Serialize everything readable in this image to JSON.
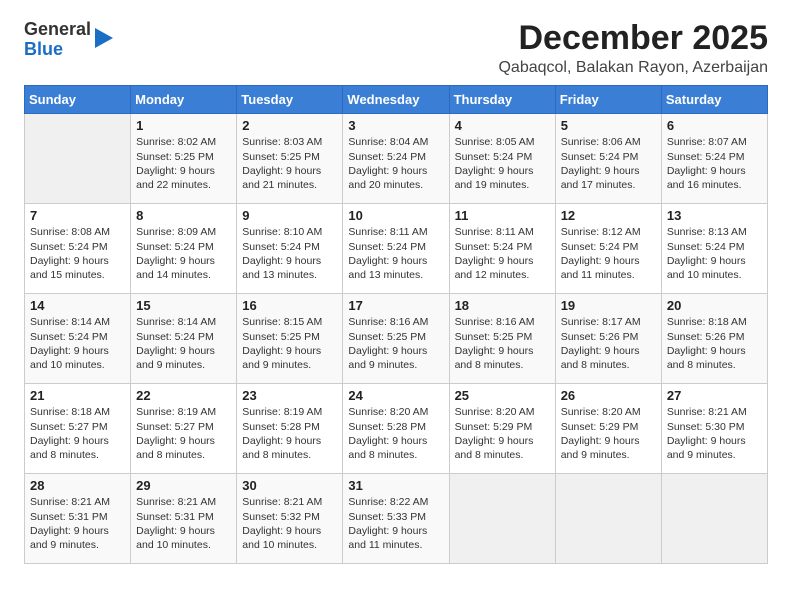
{
  "logo": {
    "general": "General",
    "blue": "Blue"
  },
  "title": "December 2025",
  "location": "Qabaqcol, Balakan Rayon, Azerbaijan",
  "days_of_week": [
    "Sunday",
    "Monday",
    "Tuesday",
    "Wednesday",
    "Thursday",
    "Friday",
    "Saturday"
  ],
  "weeks": [
    [
      {
        "day": "",
        "info": ""
      },
      {
        "day": "1",
        "info": "Sunrise: 8:02 AM\nSunset: 5:25 PM\nDaylight: 9 hours\nand 22 minutes."
      },
      {
        "day": "2",
        "info": "Sunrise: 8:03 AM\nSunset: 5:25 PM\nDaylight: 9 hours\nand 21 minutes."
      },
      {
        "day": "3",
        "info": "Sunrise: 8:04 AM\nSunset: 5:24 PM\nDaylight: 9 hours\nand 20 minutes."
      },
      {
        "day": "4",
        "info": "Sunrise: 8:05 AM\nSunset: 5:24 PM\nDaylight: 9 hours\nand 19 minutes."
      },
      {
        "day": "5",
        "info": "Sunrise: 8:06 AM\nSunset: 5:24 PM\nDaylight: 9 hours\nand 17 minutes."
      },
      {
        "day": "6",
        "info": "Sunrise: 8:07 AM\nSunset: 5:24 PM\nDaylight: 9 hours\nand 16 minutes."
      }
    ],
    [
      {
        "day": "7",
        "info": "Sunrise: 8:08 AM\nSunset: 5:24 PM\nDaylight: 9 hours\nand 15 minutes."
      },
      {
        "day": "8",
        "info": "Sunrise: 8:09 AM\nSunset: 5:24 PM\nDaylight: 9 hours\nand 14 minutes."
      },
      {
        "day": "9",
        "info": "Sunrise: 8:10 AM\nSunset: 5:24 PM\nDaylight: 9 hours\nand 13 minutes."
      },
      {
        "day": "10",
        "info": "Sunrise: 8:11 AM\nSunset: 5:24 PM\nDaylight: 9 hours\nand 13 minutes."
      },
      {
        "day": "11",
        "info": "Sunrise: 8:11 AM\nSunset: 5:24 PM\nDaylight: 9 hours\nand 12 minutes."
      },
      {
        "day": "12",
        "info": "Sunrise: 8:12 AM\nSunset: 5:24 PM\nDaylight: 9 hours\nand 11 minutes."
      },
      {
        "day": "13",
        "info": "Sunrise: 8:13 AM\nSunset: 5:24 PM\nDaylight: 9 hours\nand 10 minutes."
      }
    ],
    [
      {
        "day": "14",
        "info": "Sunrise: 8:14 AM\nSunset: 5:24 PM\nDaylight: 9 hours\nand 10 minutes."
      },
      {
        "day": "15",
        "info": "Sunrise: 8:14 AM\nSunset: 5:24 PM\nDaylight: 9 hours\nand 9 minutes."
      },
      {
        "day": "16",
        "info": "Sunrise: 8:15 AM\nSunset: 5:25 PM\nDaylight: 9 hours\nand 9 minutes."
      },
      {
        "day": "17",
        "info": "Sunrise: 8:16 AM\nSunset: 5:25 PM\nDaylight: 9 hours\nand 9 minutes."
      },
      {
        "day": "18",
        "info": "Sunrise: 8:16 AM\nSunset: 5:25 PM\nDaylight: 9 hours\nand 8 minutes."
      },
      {
        "day": "19",
        "info": "Sunrise: 8:17 AM\nSunset: 5:26 PM\nDaylight: 9 hours\nand 8 minutes."
      },
      {
        "day": "20",
        "info": "Sunrise: 8:18 AM\nSunset: 5:26 PM\nDaylight: 9 hours\nand 8 minutes."
      }
    ],
    [
      {
        "day": "21",
        "info": "Sunrise: 8:18 AM\nSunset: 5:27 PM\nDaylight: 9 hours\nand 8 minutes."
      },
      {
        "day": "22",
        "info": "Sunrise: 8:19 AM\nSunset: 5:27 PM\nDaylight: 9 hours\nand 8 minutes."
      },
      {
        "day": "23",
        "info": "Sunrise: 8:19 AM\nSunset: 5:28 PM\nDaylight: 9 hours\nand 8 minutes."
      },
      {
        "day": "24",
        "info": "Sunrise: 8:20 AM\nSunset: 5:28 PM\nDaylight: 9 hours\nand 8 minutes."
      },
      {
        "day": "25",
        "info": "Sunrise: 8:20 AM\nSunset: 5:29 PM\nDaylight: 9 hours\nand 8 minutes."
      },
      {
        "day": "26",
        "info": "Sunrise: 8:20 AM\nSunset: 5:29 PM\nDaylight: 9 hours\nand 9 minutes."
      },
      {
        "day": "27",
        "info": "Sunrise: 8:21 AM\nSunset: 5:30 PM\nDaylight: 9 hours\nand 9 minutes."
      }
    ],
    [
      {
        "day": "28",
        "info": "Sunrise: 8:21 AM\nSunset: 5:31 PM\nDaylight: 9 hours\nand 9 minutes."
      },
      {
        "day": "29",
        "info": "Sunrise: 8:21 AM\nSunset: 5:31 PM\nDaylight: 9 hours\nand 10 minutes."
      },
      {
        "day": "30",
        "info": "Sunrise: 8:21 AM\nSunset: 5:32 PM\nDaylight: 9 hours\nand 10 minutes."
      },
      {
        "day": "31",
        "info": "Sunrise: 8:22 AM\nSunset: 5:33 PM\nDaylight: 9 hours\nand 11 minutes."
      },
      {
        "day": "",
        "info": ""
      },
      {
        "day": "",
        "info": ""
      },
      {
        "day": "",
        "info": ""
      }
    ]
  ]
}
